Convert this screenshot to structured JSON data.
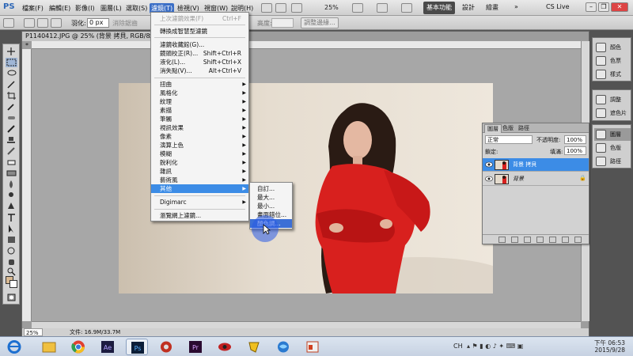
{
  "app": {
    "logo": "PS"
  },
  "menubar": {
    "items": [
      "檔案(F)",
      "編輯(E)",
      "影像(I)",
      "圖層(L)",
      "選取(S)",
      "濾鏡(T)",
      "檢視(V)",
      "視窗(W)",
      "說明(H)"
    ],
    "zoom": "25%",
    "workspace": "基本功能",
    "workspace_links": [
      "設計",
      "繪畫"
    ],
    "cslive": "CS Live"
  },
  "options": {
    "feather_label": "羽化:",
    "feather_value": "0 px",
    "antialias": "消除鋸齒",
    "height_label": "高度:",
    "refine_edge": "調整邊緣..."
  },
  "document": {
    "tab_title": "P1140412.JPG @ 25% (背景 拷貝, RGB/8) *",
    "tab_close": "×",
    "zoom": "25%",
    "doc_size": "文件: 16.9M/33.7M"
  },
  "filter_menu": {
    "items": [
      {
        "label": "上次濾鏡效果(F)",
        "shortcut": "Ctrl+F",
        "disabled": true
      },
      {
        "label": "轉換成智慧型濾鏡",
        "shortcut": ""
      },
      {
        "label": "濾鏡收藏館(G)...",
        "shortcut": ""
      },
      {
        "label": "鏡頭校正(R)...",
        "shortcut": "Shift+Ctrl+R"
      },
      {
        "label": "液化(L)...",
        "shortcut": "Shift+Ctrl+X"
      },
      {
        "label": "消失點(V)...",
        "shortcut": "Alt+Ctrl+V"
      },
      {
        "label": "扭曲",
        "submenu": true
      },
      {
        "label": "風格化",
        "submenu": true
      },
      {
        "label": "紋理",
        "submenu": true
      },
      {
        "label": "素描",
        "submenu": true
      },
      {
        "label": "筆觸",
        "submenu": true
      },
      {
        "label": "視訊效果",
        "submenu": true
      },
      {
        "label": "像素",
        "submenu": true
      },
      {
        "label": "演算上色",
        "submenu": true
      },
      {
        "label": "模糊",
        "submenu": true
      },
      {
        "label": "銳利化",
        "submenu": true
      },
      {
        "label": "雜訊",
        "submenu": true
      },
      {
        "label": "藝術風",
        "submenu": true
      },
      {
        "label": "其他",
        "submenu": true,
        "highlighted": true
      },
      {
        "label": "Digimarc",
        "submenu": true
      },
      {
        "label": "瀏覽網上濾鏡...",
        "shortcut": ""
      }
    ]
  },
  "other_submenu": {
    "items": [
      "自訂...",
      "最大...",
      "最小...",
      "畫面錯位...",
      "顏色調..."
    ]
  },
  "layers_panel": {
    "tabs": [
      "圖層",
      "色版",
      "路徑"
    ],
    "blend_mode": "正常",
    "opacity_label": "不透明度:",
    "opacity_value": "100%",
    "lock_label": "鎖定:",
    "fill_label": "填滿:",
    "fill_value": "100%",
    "layers": [
      {
        "name": "背景 拷貝",
        "selected": true
      },
      {
        "name": "背景",
        "selected": false,
        "locked": true
      }
    ]
  },
  "right_dock": {
    "group1": [
      "顏色",
      "色票",
      "樣式"
    ],
    "group2": [
      "調整",
      "遮色片"
    ],
    "group3": [
      "圖層",
      "色版",
      "路徑"
    ]
  },
  "taskbar": {
    "lang": "CH",
    "time": "下午 06:53",
    "date": "2015/9/28"
  },
  "colors": {
    "accent": "#3c8ce6",
    "photo_background": "#e2d8ca",
    "dress": "#d8201e"
  }
}
